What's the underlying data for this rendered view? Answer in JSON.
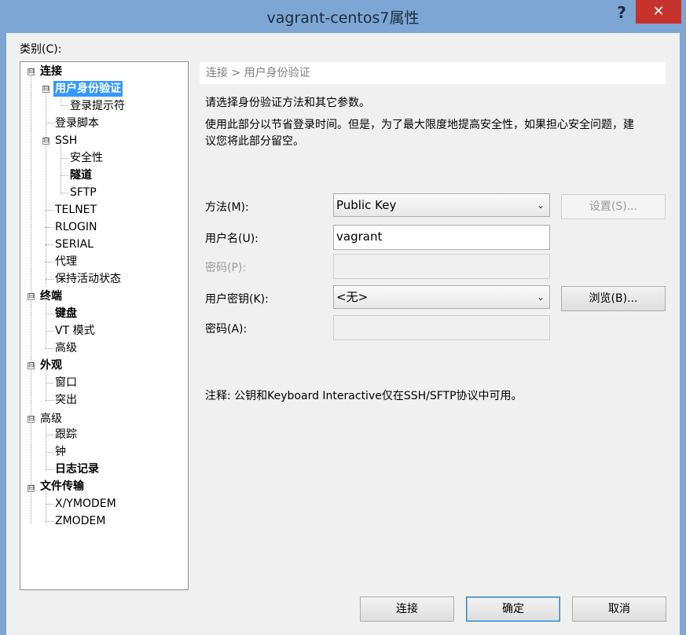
{
  "window": {
    "title": "vagrant-centos7属性",
    "help_glyph": "?",
    "close_glyph": "✕"
  },
  "category_label": "类别(C):",
  "tree": {
    "n0": "连接",
    "n1": "用户身份验证",
    "n2": "登录提示符",
    "n3": "登录脚本",
    "n4": "SSH",
    "n5": "安全性",
    "n6": "隧道",
    "n7": "SFTP",
    "n8": "TELNET",
    "n9": "RLOGIN",
    "n10": "SERIAL",
    "n11": "代理",
    "n12": "保持活动状态",
    "n13": "终端",
    "n14": "键盘",
    "n15": "VT 模式",
    "n16": "高级",
    "n17": "外观",
    "n18": "窗口",
    "n19": "突出",
    "n20": "高级",
    "n21": "跟踪",
    "n22": "钟",
    "n23": "日志记录",
    "n24": "文件传输",
    "n25": "X/YMODEM",
    "n26": "ZMODEM"
  },
  "panel": {
    "breadcrumb": "连接 > 用户身份验证",
    "desc1": "请选择身份验证方法和其它参数。",
    "desc2": "使用此部分以节省登录时间。但是，为了最大限度地提高安全性，如果担心安全问题，建",
    "desc3": "议您将此部分留空。",
    "method_label": "方法(M):",
    "method_value": "Public Key",
    "settings_button": "设置(S)...",
    "username_label": "用户名(U):",
    "username_value": "vagrant",
    "password_label": "密码(P):",
    "userkey_label": "用户密钥(K):",
    "userkey_value": "<无>",
    "browse_button": "浏览(B)...",
    "passphrase_label": "密码(A):",
    "note": "注释: 公钥和Keyboard Interactive仅在SSH/SFTP协议中可用。"
  },
  "buttons": {
    "connect": "连接",
    "ok": "确定",
    "cancel": "取消"
  },
  "icons": {
    "expand": "⊟",
    "dropdown": "⌄"
  }
}
